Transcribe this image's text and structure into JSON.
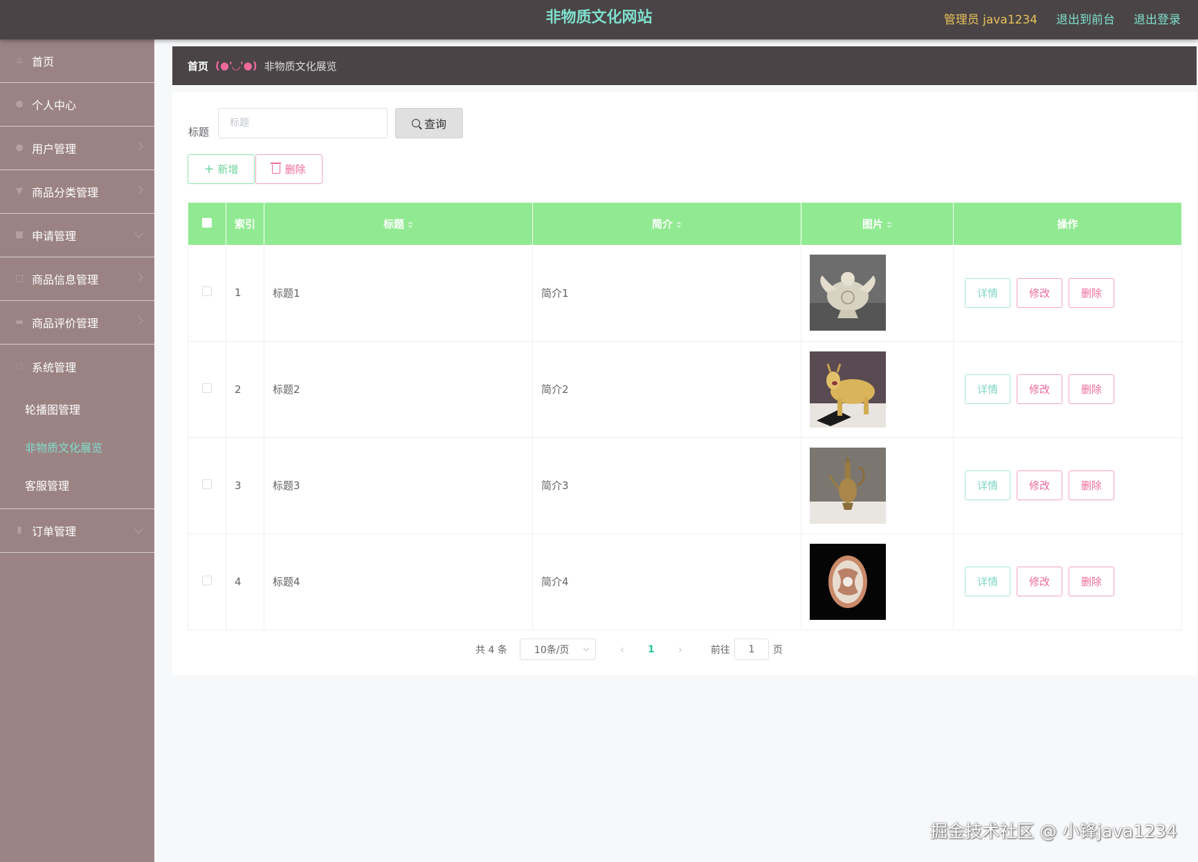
{
  "header": {
    "site_title": "非物质文化网站",
    "admin_label": "管理员 java1234",
    "back_label": "退出到前台",
    "logout_label": "退出登录"
  },
  "sidebar": {
    "items": [
      {
        "label": "首页",
        "icon": "home-icon"
      },
      {
        "label": "个人中心",
        "icon": "user-icon"
      },
      {
        "label": "用户管理",
        "icon": "users-icon"
      },
      {
        "label": "商品分类管理",
        "icon": "category-icon"
      },
      {
        "label": "申请管理",
        "icon": "apply-icon"
      },
      {
        "label": "商品信息管理",
        "icon": "goods-icon"
      },
      {
        "label": "商品评价管理",
        "icon": "comment-icon"
      },
      {
        "label": "系统管理",
        "icon": "system-icon"
      },
      {
        "label": "订单管理",
        "icon": "order-icon"
      }
    ],
    "system_sub": [
      "轮播图管理",
      "非物质文化展览",
      "客服管理"
    ]
  },
  "breadcrumb": {
    "home": "首页",
    "separator": "(●'◡'●)",
    "current": "非物质文化展览"
  },
  "search": {
    "label": "标题",
    "placeholder": "标题",
    "button_label": "查询"
  },
  "actions": {
    "add_label": "新增",
    "delete_label": "删除"
  },
  "table": {
    "headers": [
      "索引",
      "标题",
      "简介",
      "图片",
      "操作"
    ],
    "rows": [
      {
        "index": "1",
        "title": "标题1",
        "intro": "简介1"
      },
      {
        "index": "2",
        "title": "标题2",
        "intro": "简介2"
      },
      {
        "index": "3",
        "title": "标题3",
        "intro": "简介3"
      },
      {
        "index": "4",
        "title": "标题4",
        "intro": "简介4"
      }
    ],
    "op_labels": {
      "detail": "详情",
      "edit": "修改",
      "delete": "删除"
    }
  },
  "pagination": {
    "total": "共 4 条",
    "page_size": "10条/页",
    "current_page": "1",
    "goto_label": "前往",
    "goto_value": "1",
    "page_suffix": "页"
  },
  "watermark": "掘金技术社区 @ 小锋java1234",
  "colors": {
    "topbar": "#4a4446",
    "sidebar": "#9b8384",
    "accent_teal": "#7fe0cd",
    "table_header": "#91ea91",
    "pink": "#ee6a9b"
  }
}
